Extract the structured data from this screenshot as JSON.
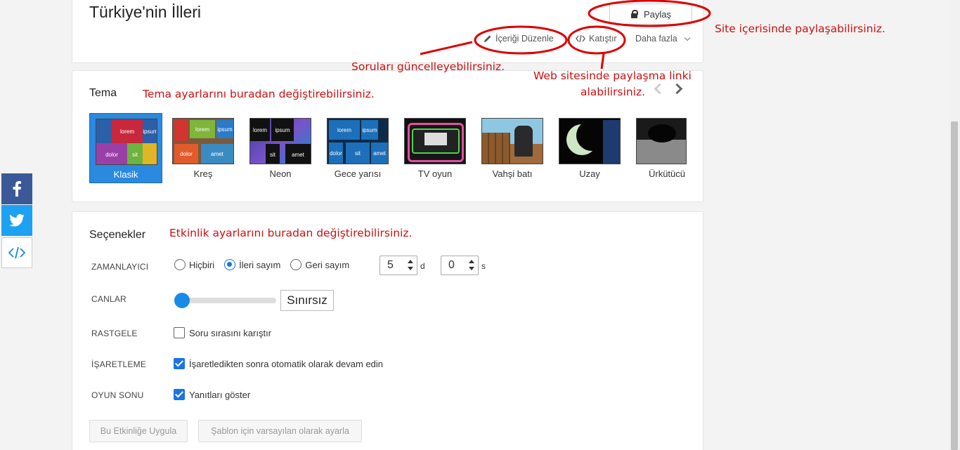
{
  "header": {
    "title": "Türkiye'nin İlleri",
    "share_label": "Paylaş",
    "edit_label": "İçeriği Düzenle",
    "embed_label": "Katıştır",
    "more_label": "Daha fazla"
  },
  "annotations": {
    "share": "Site içerisinde paylaşabilirsiniz.",
    "edit": "Soruları güncelleyebilirsiniz.",
    "embed_line1": "Web sitesinde paylaşma linki",
    "embed_line2": "alabilirsiniz.",
    "theme": "Tema ayarlarını buradan değiştirebilirsiniz.",
    "options": "Etkinlik ayarlarını buradan değiştirebilirsiniz."
  },
  "theme_section": {
    "title": "Tema",
    "themes": [
      {
        "label": "Klasik",
        "selected": true
      },
      {
        "label": "Kreş",
        "selected": false
      },
      {
        "label": "Neon",
        "selected": false
      },
      {
        "label": "Gece yarısı",
        "selected": false
      },
      {
        "label": "TV oyun",
        "selected": false
      },
      {
        "label": "Vahşi batı",
        "selected": false
      },
      {
        "label": "Uzay",
        "selected": false
      },
      {
        "label": "Ürkütücü",
        "selected": false
      }
    ],
    "tiles": {
      "lorem": "lorem",
      "ipsum": "ipsum",
      "dolor": "dolor",
      "sit": "sit",
      "amet": "amet"
    }
  },
  "options": {
    "title": "Seçenekler",
    "timer": {
      "label": "ZAMANLAYICI",
      "choices": [
        "Hiçbiri",
        "İleri sayım",
        "Geri sayım"
      ],
      "selected": "İleri sayım",
      "minutes": "5",
      "minutes_unit": "d",
      "seconds": "0",
      "seconds_unit": "s"
    },
    "lives": {
      "label": "CANLAR",
      "value": "Sınırsız"
    },
    "random": {
      "label": "RASTGELE",
      "text": "Soru sırasını karıştır",
      "checked": false
    },
    "marking": {
      "label": "İŞARETLEME",
      "text": "İşaretledikten sonra otomatik olarak devam edin",
      "checked": true
    },
    "game_end": {
      "label": "OYUN SONU",
      "text": "Yanıtları göster",
      "checked": true
    },
    "apply_button": "Bu Etkinliğe Uygula",
    "default_button": "Şablon için varsayılan olarak ayarla"
  },
  "colors": {
    "accent": "#1a73e8",
    "annotation": "#cc1111",
    "facebook": "#3b5998",
    "twitter": "#1da1f2"
  }
}
